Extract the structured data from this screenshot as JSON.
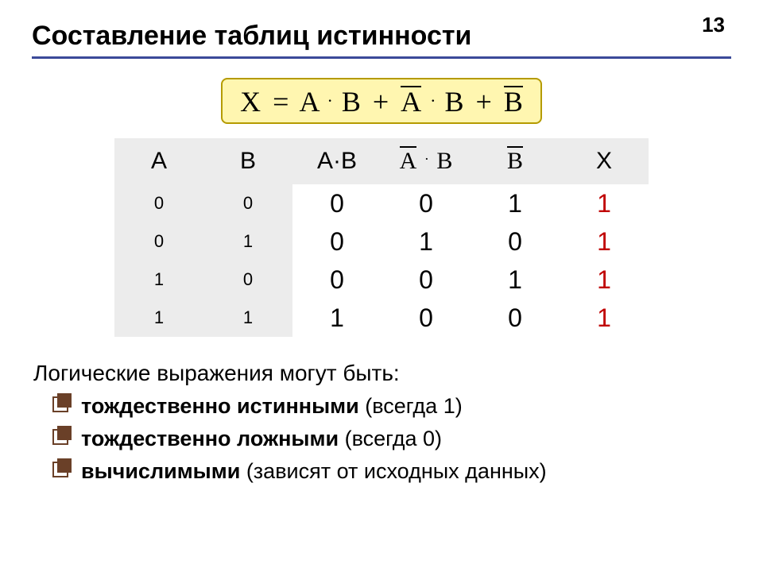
{
  "page_number": "13",
  "title": "Составление таблиц истинности",
  "formula": {
    "lhs": "X",
    "eq": "=",
    "t1a": "A",
    "t1b": "B",
    "t2a": "A",
    "t2b": "B",
    "t3": "B",
    "plus": "+"
  },
  "table": {
    "headers": {
      "A": "A",
      "B": "B",
      "AB": "A·B",
      "AbarB_a": "A",
      "AbarB_b": "B",
      "Bbar": "B",
      "X": "X"
    },
    "rows": [
      {
        "A": "0",
        "B": "0",
        "AB": "0",
        "AbarB": "0",
        "Bbar": "1",
        "X": "1"
      },
      {
        "A": "0",
        "B": "1",
        "AB": "0",
        "AbarB": "1",
        "Bbar": "0",
        "X": "1"
      },
      {
        "A": "1",
        "B": "0",
        "AB": "0",
        "AbarB": "0",
        "Bbar": "1",
        "X": "1"
      },
      {
        "A": "1",
        "B": "1",
        "AB": "1",
        "AbarB": "0",
        "Bbar": "0",
        "X": "1"
      }
    ]
  },
  "body_intro": "Логические выражения могут быть:",
  "bullets": [
    {
      "strong": "тождественно истинными",
      "rest": " (всегда 1)"
    },
    {
      "strong": "тождественно ложными",
      "rest": " (всегда 0)"
    },
    {
      "strong": "вычислимыми",
      "rest": " (зависят от исходных данных)"
    }
  ],
  "chart_data": {
    "type": "table",
    "title": "Truth table for X = A·B + NOT(A)·B + NOT(B)",
    "columns": [
      "A",
      "B",
      "A·B",
      "NOT(A)·B",
      "NOT(B)",
      "X"
    ],
    "rows": [
      [
        0,
        0,
        0,
        0,
        1,
        1
      ],
      [
        0,
        1,
        0,
        1,
        0,
        1
      ],
      [
        1,
        0,
        0,
        0,
        1,
        1
      ],
      [
        1,
        1,
        1,
        0,
        0,
        1
      ]
    ]
  }
}
